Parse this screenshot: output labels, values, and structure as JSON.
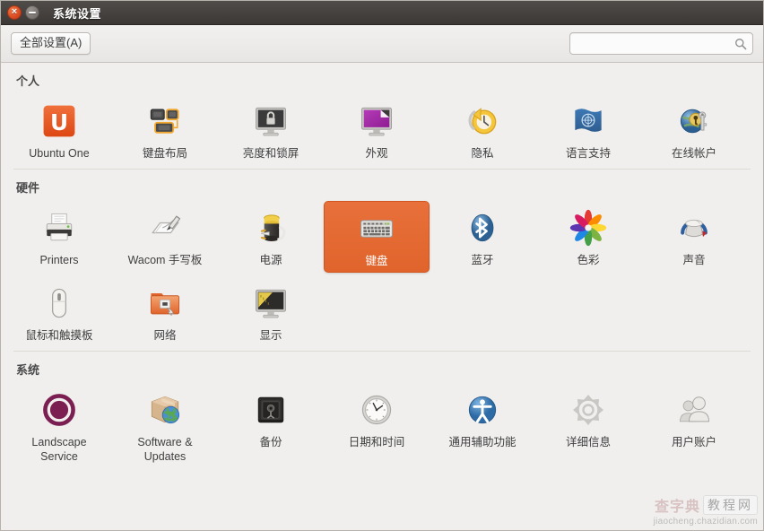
{
  "window": {
    "title": "系统设置",
    "close_glyph": "×",
    "minimize_glyph": "−"
  },
  "toolbar": {
    "all_settings_label": "全部设置(A)",
    "search_value": "",
    "search_placeholder": ""
  },
  "sections": [
    {
      "title": "个人",
      "items": [
        {
          "label": "Ubuntu One",
          "icon": "ubuntu-one-icon",
          "selected": false
        },
        {
          "label": "键盘布局",
          "icon": "keyboard-layout-icon",
          "selected": false
        },
        {
          "label": "亮度和锁屏",
          "icon": "brightness-lock-icon",
          "selected": false
        },
        {
          "label": "外观",
          "icon": "appearance-icon",
          "selected": false
        },
        {
          "label": "隐私",
          "icon": "privacy-icon",
          "selected": false
        },
        {
          "label": "语言支持",
          "icon": "language-support-icon",
          "selected": false
        },
        {
          "label": "在线帐户",
          "icon": "online-accounts-icon",
          "selected": false
        }
      ]
    },
    {
      "title": "硬件",
      "items": [
        {
          "label": "Printers",
          "icon": "printer-icon",
          "selected": false
        },
        {
          "label": "Wacom 手写板",
          "icon": "wacom-tablet-icon",
          "selected": false
        },
        {
          "label": "电源",
          "icon": "power-icon",
          "selected": false
        },
        {
          "label": "键盘",
          "icon": "keyboard-icon",
          "selected": true
        },
        {
          "label": "蓝牙",
          "icon": "bluetooth-icon",
          "selected": false
        },
        {
          "label": "色彩",
          "icon": "color-icon",
          "selected": false
        },
        {
          "label": "声音",
          "icon": "sound-icon",
          "selected": false
        },
        {
          "label": "鼠标和触摸板",
          "icon": "mouse-touchpad-icon",
          "selected": false
        },
        {
          "label": "网络",
          "icon": "network-icon",
          "selected": false
        },
        {
          "label": "显示",
          "icon": "display-icon",
          "selected": false
        }
      ]
    },
    {
      "title": "系统",
      "items": [
        {
          "label": "Landscape Service",
          "icon": "landscape-service-icon",
          "selected": false
        },
        {
          "label": "Software & Updates",
          "icon": "software-updates-icon",
          "selected": false
        },
        {
          "label": "备份",
          "icon": "backup-icon",
          "selected": false
        },
        {
          "label": "日期和时间",
          "icon": "date-time-icon",
          "selected": false
        },
        {
          "label": "通用辅助功能",
          "icon": "accessibility-icon",
          "selected": false
        },
        {
          "label": "详细信息",
          "icon": "details-icon",
          "selected": false
        },
        {
          "label": "用户账户",
          "icon": "user-accounts-icon",
          "selected": false
        }
      ]
    }
  ],
  "watermark": {
    "brand_cn": "查字典",
    "brand_tag": "教程网",
    "url": "jiaocheng.chazidian.com"
  },
  "colors": {
    "accent": "#e0642c",
    "titlebar": "#3c3835",
    "background": "#f0efee"
  }
}
